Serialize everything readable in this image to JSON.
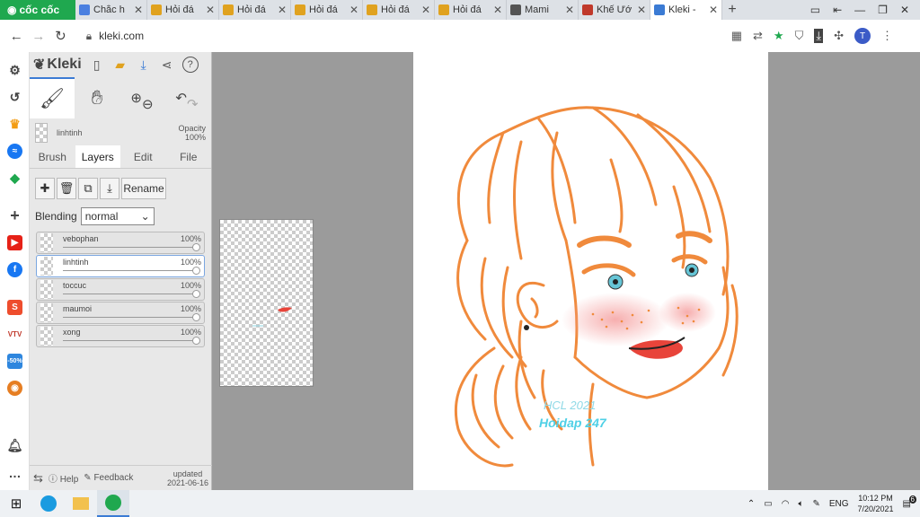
{
  "browser": {
    "brand": "cốc cốc",
    "tabs": [
      {
        "title": "Chắc h",
        "icon": "docs-icon",
        "color": "#4a7fe0",
        "active": false
      },
      {
        "title": "Hỏi đá",
        "icon": "hoidap-icon",
        "color": "#e0a21f",
        "active": false
      },
      {
        "title": "Hỏi đá",
        "icon": "hoidap-icon",
        "color": "#e0a21f",
        "active": false
      },
      {
        "title": "Hỏi đá",
        "icon": "hoidap-icon",
        "color": "#e0a21f",
        "active": false
      },
      {
        "title": "Hỏi đá",
        "icon": "hoidap-icon",
        "color": "#e0a21f",
        "active": false
      },
      {
        "title": "Hỏi đá",
        "icon": "hoidap-icon",
        "color": "#e0a21f",
        "active": false
      },
      {
        "title": "Mami",
        "icon": "globe-icon",
        "color": "#555555",
        "active": false
      },
      {
        "title": "Khế Ướ",
        "icon": "site-icon",
        "color": "#c0392b",
        "active": false
      },
      {
        "title": "Kleki -",
        "icon": "kleki-icon",
        "color": "#3b7bd4",
        "active": true
      }
    ],
    "new_tab": "+",
    "url": "kleki.com",
    "avatar_letter": "T"
  },
  "app": {
    "logo_text": "Kleki",
    "current_layer": "linhtinh",
    "opacity_label": "Opacity",
    "opacity_value": "100%",
    "tabs": [
      {
        "label": "Brush",
        "selected": false
      },
      {
        "label": "Layers",
        "selected": true
      },
      {
        "label": "Edit",
        "selected": false
      },
      {
        "label": "File",
        "selected": false
      }
    ],
    "rename_label": "Rename",
    "blending_label": "Blending",
    "blending_value": "normal",
    "layers": [
      {
        "name": "vebophan",
        "opacity": "100%",
        "selected": false
      },
      {
        "name": "linhtinh",
        "opacity": "100%",
        "selected": true
      },
      {
        "name": "toccuc",
        "opacity": "100%",
        "selected": false
      },
      {
        "name": "maumoi",
        "opacity": "100%",
        "selected": false
      },
      {
        "name": "xong",
        "opacity": "100%",
        "selected": false
      }
    ],
    "footer": {
      "help": "Help",
      "feedback": "Feedback",
      "updated_label": "updated",
      "updated_date": "2021-06-16"
    }
  },
  "drawing": {
    "signature_line1": "HCL 2021",
    "signature_line2": "Hoidap 247"
  },
  "colors": {
    "stroke": "#f08a3c",
    "eye": "#66c5d6",
    "lips": "#e8443a",
    "blush": "#f5a0a0",
    "signature": "#6ad0e0"
  },
  "taskbar": {
    "language": "ENG",
    "time": "10:12 PM",
    "date": "7/20/2021",
    "notifications": "6"
  }
}
